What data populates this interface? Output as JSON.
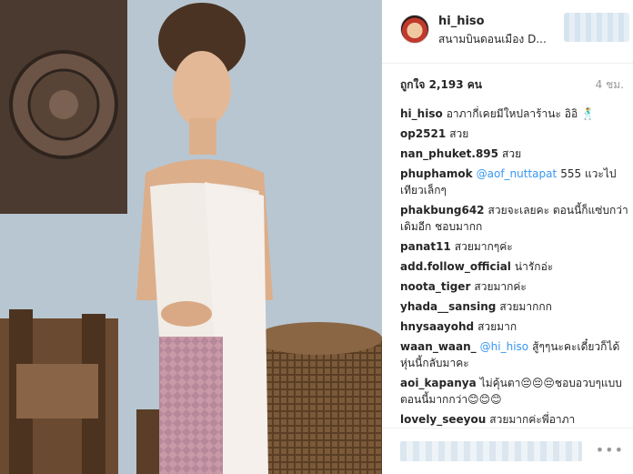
{
  "header": {
    "username": "hi_hiso",
    "location": "สนามบินดอนเมือง D...",
    "avatar_icon": "profile-avatar"
  },
  "meta": {
    "likes": "ถูกใจ 2,193 คน",
    "time": "4 ชม."
  },
  "comments": [
    {
      "user": "hi_hiso",
      "mention": "",
      "text": "อาภากี่เคยมีใหปลาร้านะ อิอิ 🕺"
    },
    {
      "user": "op2521",
      "mention": "",
      "text": "สวย"
    },
    {
      "user": "nan_phuket.895",
      "mention": "",
      "text": "สวย"
    },
    {
      "user": "phuphamok",
      "mention": "@aof_nuttapat",
      "text": "555 แวะไปเทียวเล็กๆ"
    },
    {
      "user": "phakbung642",
      "mention": "",
      "text": "สวยจะเลยคะ ตอนนี้ก็แซ่บกว่าเดิมอีก ชอบมากก"
    },
    {
      "user": "panat11",
      "mention": "",
      "text": "สวยมากๆค่ะ"
    },
    {
      "user": "add.follow_official",
      "mention": "",
      "text": "น่ารักอ่ะ"
    },
    {
      "user": "noota_tiger",
      "mention": "",
      "text": "สวยมากค่ะ"
    },
    {
      "user": "yhada__sansing",
      "mention": "",
      "text": "สวยมากกก"
    },
    {
      "user": "hnysaayohd",
      "mention": "",
      "text": "สวยมาก"
    },
    {
      "user": "waan_waan_",
      "mention": "@hi_hiso",
      "text": "สู้ๆๆนะคะเดี๋ยวก็ได้หุ่นนี้กลับมาคะ"
    },
    {
      "user": "aoi_kapanya",
      "mention": "",
      "text": "ไม่คุ้นตา😔😔😔ชอบอวบๆแบบตอนนี้มากกว่า😊😊😊"
    },
    {
      "user": "lovely_seeyou",
      "mention": "",
      "text": "สวยมากค่ะพี่อาภา"
    }
  ],
  "footer": {
    "more_label": "•••"
  },
  "colors": {
    "mention": "#3897f0",
    "text": "#262626",
    "muted": "#999999"
  }
}
